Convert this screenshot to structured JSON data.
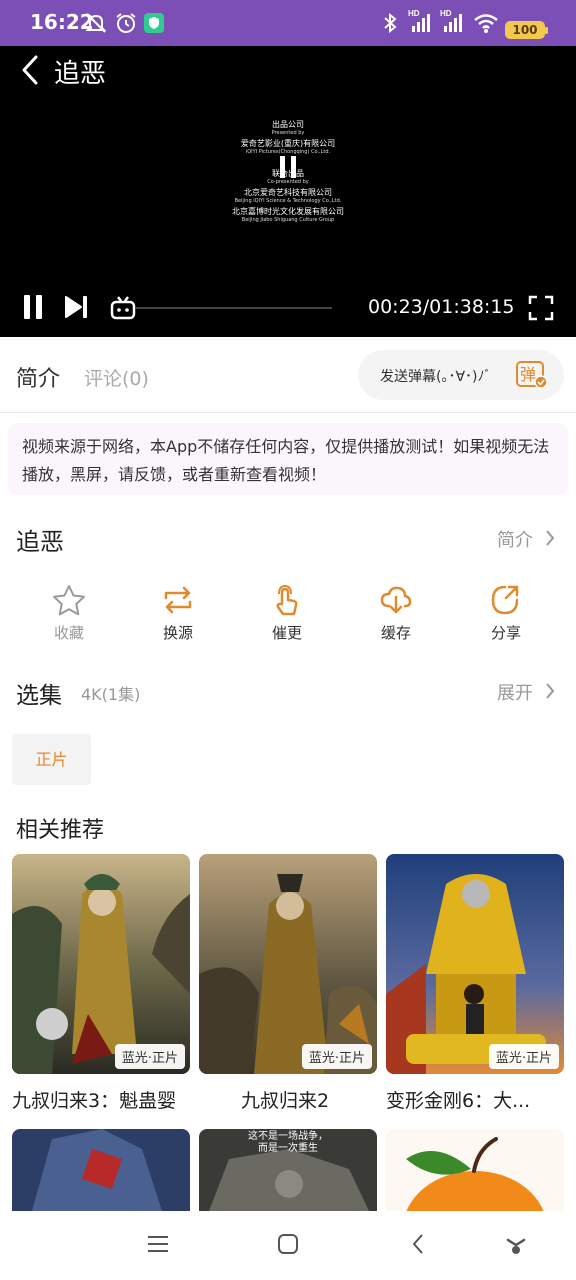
{
  "status_bar": {
    "time": "16:22",
    "battery": "100",
    "hd_label_1": "HD",
    "hd_label_2": "HD"
  },
  "player": {
    "title": "追恶",
    "credits": [
      {
        "cn": "出品公司",
        "en": "Presented by"
      },
      {
        "cn": "爱奇艺影业(重庆)有限公司",
        "en": "iQIYI Pictures(Chongqing) Co.,Ltd."
      },
      {
        "cn": "联合出品",
        "en": "Co-presented by"
      },
      {
        "cn": "北京爱奇艺科技有限公司",
        "en": "Beijing iQIYI Science & Technology Co.,Ltd."
      },
      {
        "cn": "北京嘉博时光文化发展有限公司",
        "en": "Beijing Jiabo Shiguang Culture Group"
      }
    ],
    "timecode": "00:23/01:38:15",
    "progress": 0.004
  },
  "tabs": {
    "intro": "简介",
    "comments": "评论(0)"
  },
  "danmaku": {
    "placeholder": "发送弹幕(｡･∀･)ﾉﾞ",
    "icon_char": "弹"
  },
  "notice": "视频来源于网络，本App不储存任何内容，仅提供播放测试！如果视频无法播放，黑屏，请反馈，或者重新查看视频！",
  "video": {
    "title": "追恶",
    "intro_link": "简介"
  },
  "actions": [
    {
      "label": "收藏",
      "icon": "star-icon"
    },
    {
      "label": "换源",
      "icon": "swap-icon"
    },
    {
      "label": "催更",
      "icon": "tap-icon"
    },
    {
      "label": "缓存",
      "icon": "cloud-download-icon"
    },
    {
      "label": "分享",
      "icon": "share-icon"
    }
  ],
  "episodes": {
    "title": "选集",
    "meta": "4K(1集)",
    "expand": "展开",
    "items": [
      "正片"
    ]
  },
  "related": {
    "title": "相关推荐",
    "items": [
      {
        "title": "九叔归来3：魁蛊婴",
        "badge": "蓝光·正片"
      },
      {
        "title": "九叔归来2",
        "badge": "蓝光·正片"
      },
      {
        "title": "变形金刚6：大...",
        "badge": "蓝光·正片"
      }
    ],
    "row2_poster_text": [
      "这不是一场战争，",
      "而是一次重生"
    ]
  },
  "colors": {
    "status_bar": "#7b4fb6",
    "accent": "#e08a2e",
    "player_bg": "#000000"
  }
}
